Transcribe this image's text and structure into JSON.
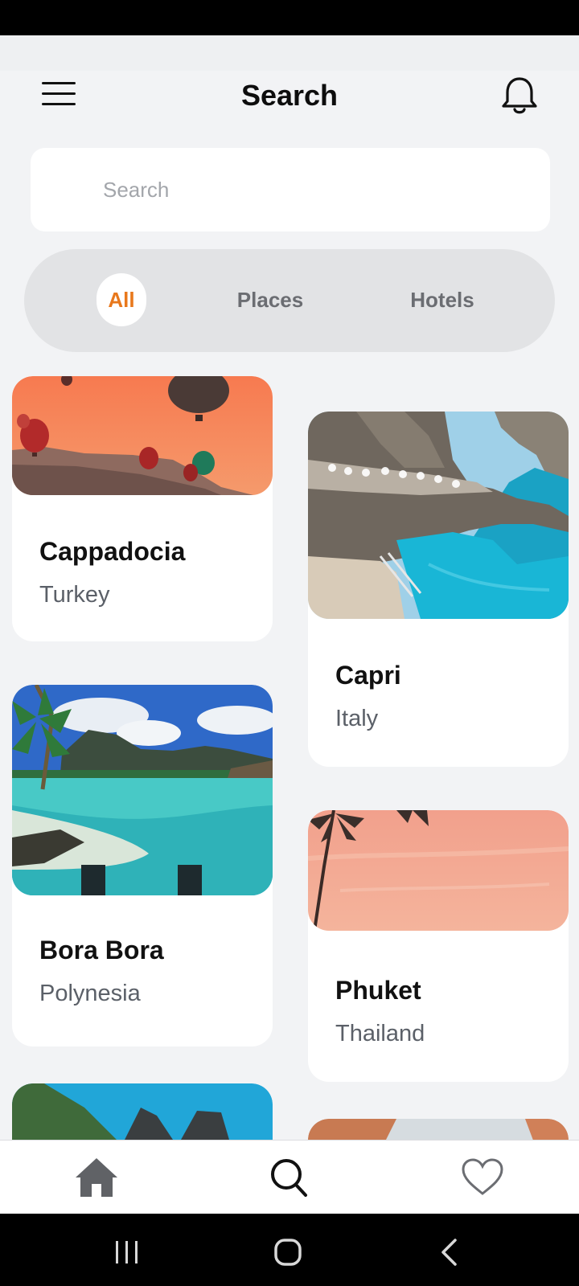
{
  "header": {
    "title": "Search",
    "menu_icon": "hamburger-menu-icon",
    "notification_icon": "bell-icon"
  },
  "search": {
    "placeholder": "Search",
    "value": ""
  },
  "filters": {
    "tabs": [
      {
        "label": "All",
        "active": true
      },
      {
        "label": "Places",
        "active": false
      },
      {
        "label": "Hotels",
        "active": false
      }
    ],
    "active_color": "#e8781c"
  },
  "destinations": [
    {
      "name": "Cappadocia",
      "country": "Turkey"
    },
    {
      "name": "Capri",
      "country": "Italy"
    },
    {
      "name": "Bora Bora",
      "country": "Polynesia"
    },
    {
      "name": "Phuket",
      "country": "Thailand"
    }
  ],
  "bottom_nav": [
    {
      "icon": "home-icon",
      "active": false
    },
    {
      "icon": "search-icon",
      "active": true
    },
    {
      "icon": "heart-icon",
      "active": false
    }
  ],
  "system_nav": [
    "recent-apps-icon",
    "home-button-icon",
    "back-icon"
  ]
}
